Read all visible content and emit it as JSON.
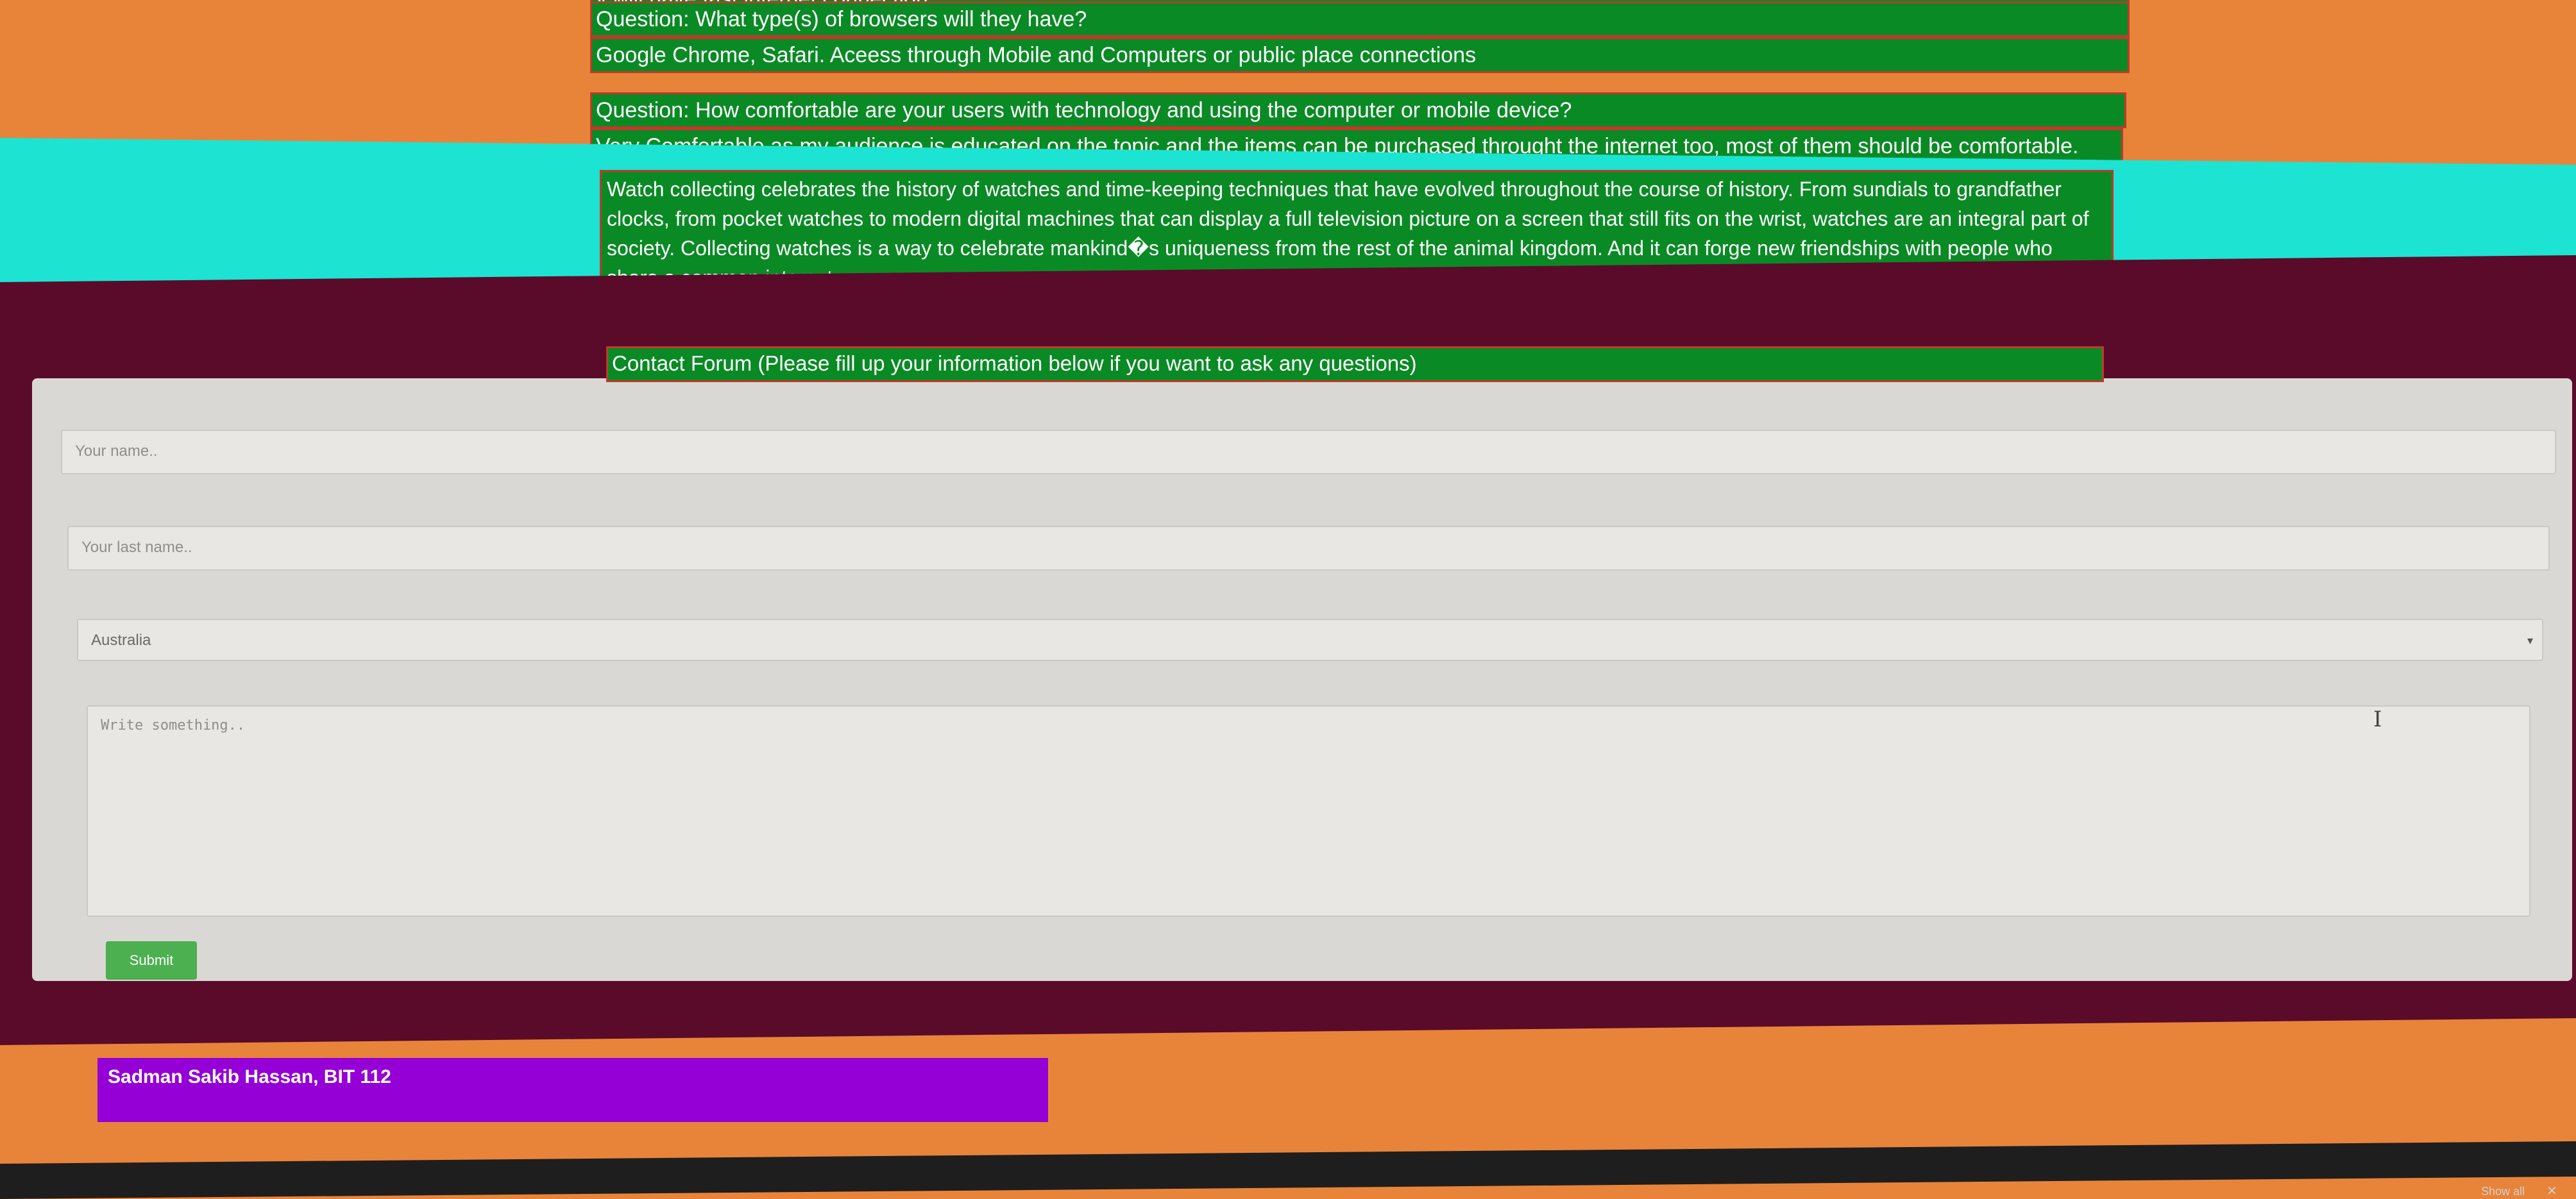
{
  "qa": {
    "rows": [
      "y will have fast internet connection.",
      "Question: What type(s) of browsers will they have?",
      "Google Chrome, Safari. Aceess through Mobile and Computers or public place connections",
      "Question: How comfortable are your users with technology and using the computer or mobile device?",
      "Very Comfortable as my audience is educated on the topic and the items can be purchased throught the internet too, most of them should be comfortable."
    ]
  },
  "intro": {
    "paragraph": "Watch collecting celebrates the history of watches and time-keeping techniques that have evolved throughout the course of history. From sundials to grandfather clocks, from pocket watches to modern digital machines that can display a full television picture on a screen that still fits on the wrist, watches are an integral part of society. Collecting watches is a way to celebrate mankind�s uniqueness from the rest of the animal kingdom. And it can forge new friendships with people who share a common interest."
  },
  "contact": {
    "header": "Contact Forum (Please fill up your information below if you want to ask any questions)",
    "first_name_placeholder": "Your name..",
    "last_name_placeholder": "Your last name..",
    "country_value": "Australia",
    "message_placeholder": "Write something..",
    "submit_label": "Submit"
  },
  "footer": {
    "credit": "Sadman Sakib Hassan, BIT 112"
  },
  "browser": {
    "show_all_label": "Show all",
    "close_label": "✕"
  },
  "icons": {
    "text_cursor": "I-beam-cursor-icon",
    "select_caret": "caret-down-icon"
  },
  "colors": {
    "page_bg": "#e8843a",
    "qa_bg": "#0a8a25",
    "border": "#c0392b",
    "cyan_band": "#1de3d3",
    "maroon_band": "#5a0b2a",
    "submit_bg": "#4caf50",
    "footer_bg": "#9400d6"
  }
}
